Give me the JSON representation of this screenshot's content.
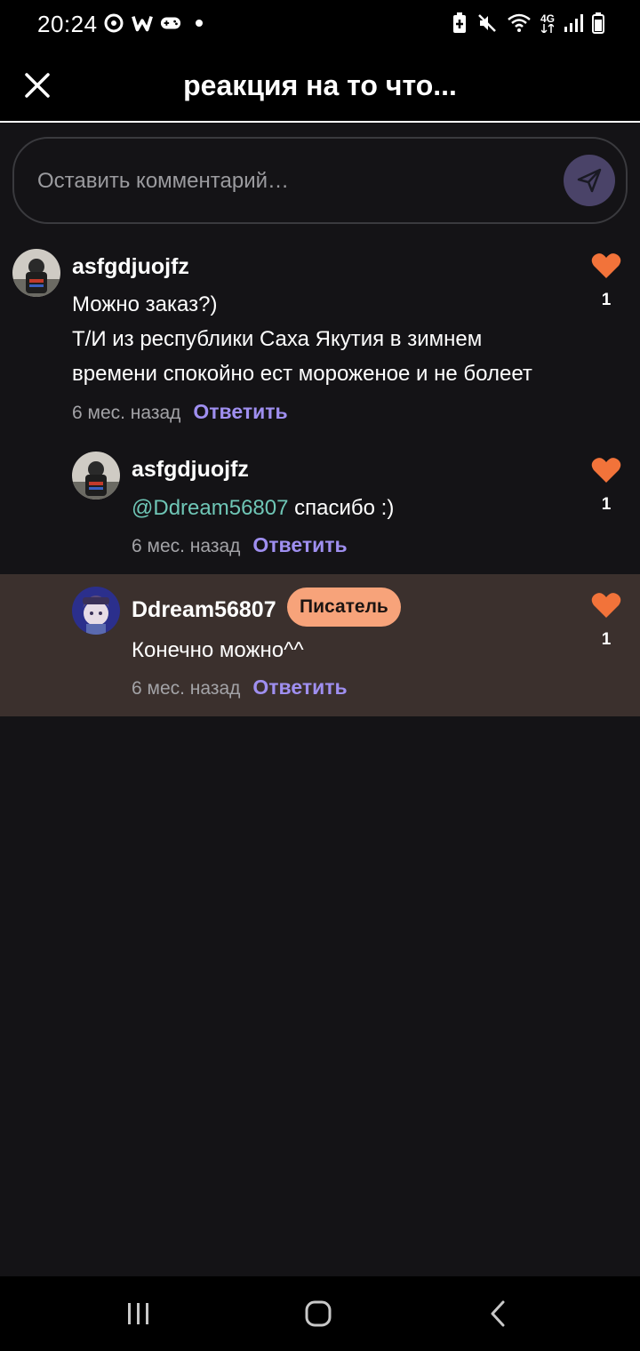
{
  "status_bar": {
    "time": "20:24",
    "left_icons": [
      "music-icon",
      "w-app-icon",
      "gamepad-icon",
      "dot-icon"
    ],
    "right_icons": [
      "battery-saver-icon",
      "mute-icon",
      "wifi-icon",
      "4g-icon",
      "signal-icon",
      "battery-icon"
    ],
    "network_label": "4G"
  },
  "header": {
    "close_icon": "close-icon",
    "title": "реакция на то что..."
  },
  "comment_input": {
    "placeholder": "Оставить комментарий…",
    "send_icon": "send-icon"
  },
  "comments": [
    {
      "username": "asfgdjuojfz",
      "lines": [
        "Можно заказ?)",
        "Т/И из республики Саха Якутия в зимнем",
        "времени спокойно ест мороженое и не болеет"
      ],
      "time": "6 мес. назад",
      "reply_label": "Ответить",
      "likes": "1",
      "avatar_icon": "avatar-icon"
    },
    {
      "username": "asfgdjuojfz",
      "mention": "@Ddream56807",
      "text": " спасибо :)",
      "time": "6 мес. назад",
      "reply_label": "Ответить",
      "likes": "1",
      "avatar_icon": "avatar-icon"
    },
    {
      "username": "Ddream56807",
      "badge": "Писатель",
      "text": "Конечно можно^^",
      "time": "6 мес. назад",
      "reply_label": "Ответить",
      "likes": "1",
      "avatar_icon": "avatar-icon"
    }
  ],
  "colors": {
    "background": "#141316",
    "accent_reply": "#9f8ff0",
    "heart": "#f2733a",
    "badge": "#f7a37a",
    "highlight_row": "#3b302d",
    "mention": "#6fc6b6"
  },
  "nav_bar": {
    "icons": [
      "recent-apps-icon",
      "home-icon",
      "back-icon"
    ]
  }
}
